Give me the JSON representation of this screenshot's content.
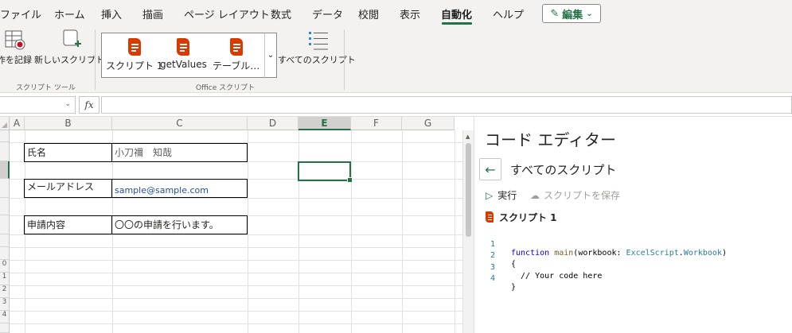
{
  "ribbon_tabs": [
    "ファイル",
    "ホーム",
    "挿入",
    "描画",
    "ページ レイアウト",
    "数式",
    "データ",
    "校閲",
    "表示",
    "自動化",
    "ヘルプ"
  ],
  "active_tab": "自動化",
  "edit_button": "編集",
  "ribbon": {
    "record_label": "作を記録",
    "new_script_label": "新しいスクリプト",
    "group_script_tools": "スクリプト ツール",
    "gallery": [
      "スクリプト 1",
      "getValues",
      "テーブル…"
    ],
    "all_scripts_label": "すべてのスクリプト",
    "group_office_scripts": "Office スクリプト"
  },
  "formula_bar": {
    "fx": "fx",
    "name_box_value": "",
    "formula_value": ""
  },
  "grid": {
    "columns": [
      "A",
      "B",
      "C",
      "D",
      "E",
      "F",
      "G"
    ],
    "selected_column": "E",
    "row_headers_bottom": [
      "0",
      "1",
      "2",
      "3",
      "4"
    ],
    "cells": {
      "name_label": "氏名",
      "name_value": "小刀禰　知哉",
      "email_label": "メールアドレス",
      "email_value": "sample@sample.com",
      "request_label": "申請内容",
      "request_value": "〇〇の申請を行います。"
    },
    "colors": {
      "email": "#1f4e9c",
      "name_value": "#605e5c",
      "accent": "#217346"
    }
  },
  "code_editor": {
    "title": "コード エディター",
    "all_scripts": "すべてのスクリプト",
    "run": "実行",
    "save": "スクリプトを保存",
    "script_name": "スクリプト 1",
    "line_numbers": [
      "1",
      "2",
      "3",
      "4"
    ],
    "code": {
      "l1_kw": "function",
      "l1_fn": "main",
      "l1_open": "(",
      "l1_param": "workbook",
      "l1_colon": ": ",
      "l1_type1": "ExcelScript",
      "l1_dot": ".",
      "l1_type2": "Workbook",
      "l1_close": ")",
      "l2": "{",
      "l3": "  // Your code here",
      "l4": "}"
    }
  }
}
